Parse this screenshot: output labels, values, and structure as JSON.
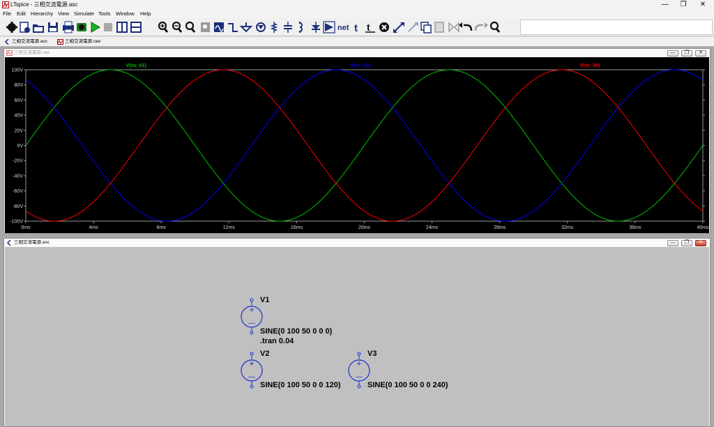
{
  "window": {
    "title": "LTspice - 三相交流電源.asc",
    "minimize": "—",
    "restore": "❐",
    "close": "✕"
  },
  "menu": [
    "File",
    "Edit",
    "Hierarchy",
    "View",
    "Simulate",
    "Tools",
    "Window",
    "Help"
  ],
  "toolbar": {
    "icons": [
      "gear-icon",
      "new-schematic-icon",
      "open-icon",
      "save-icon",
      "print-icon",
      "control-panel-icon",
      "run-icon",
      "stop-icon",
      "tile-vertical-icon",
      "tile-horizontal-icon",
      "zoom-in-icon",
      "zoom-out-icon",
      "zoom-fit-icon",
      "zoom-full-icon",
      "autorange-icon",
      "wire-icon",
      "ground-icon",
      "label-net-icon",
      "resistor-icon",
      "capacitor-icon",
      "inductor-icon",
      "diode-icon",
      "component-icon",
      "net-label-icon",
      "text-icon",
      "spice-directive-icon",
      "delete-icon",
      "move-icon",
      "drag-icon",
      "copy-icon",
      "paste-icon",
      "mirror-icon",
      "undo-icon",
      "redo-icon",
      "find-icon"
    ],
    "net_label": "net",
    "text_label": "t",
    "directive_label": "t"
  },
  "tabs": [
    {
      "label": "三相交流電源.asc",
      "icon": "schematic-icon"
    },
    {
      "label": "三相交流電源.raw",
      "icon": "waveform-icon"
    }
  ],
  "plot_window": {
    "title": "三相交流電源.raw",
    "icon": "waveform-icon"
  },
  "schematic_window": {
    "title": "三相交流電源.asc",
    "icon": "schematic-icon",
    "sources": [
      {
        "name": "V1",
        "value": "SINE(0 100 50 0 0 0)"
      },
      {
        "name": "V2",
        "value": "SINE(0 100 50 0 0 120)"
      },
      {
        "name": "V3",
        "value": "SINE(0 100 50 0 0 240)"
      }
    ],
    "directive": ".tran 0.04",
    "symbols": {
      "plus": "+",
      "minus": "—"
    }
  },
  "chart_data": {
    "type": "line",
    "background": "#000000",
    "grid": false,
    "x_unit": "ms",
    "xlim": [
      0,
      40
    ],
    "ylim": [
      -100,
      100
    ],
    "x_ticks": [
      "0ms",
      "4ms",
      "8ms",
      "12ms",
      "16ms",
      "20ms",
      "24ms",
      "28ms",
      "32ms",
      "36ms",
      "40ms"
    ],
    "x_tick_values": [
      0,
      4,
      8,
      12,
      16,
      20,
      24,
      28,
      32,
      36,
      40
    ],
    "y_ticks": [
      "100V",
      "80V",
      "60V",
      "40V",
      "20V",
      "0V",
      "-20V",
      "-40V",
      "-60V",
      "-80V",
      "-100V"
    ],
    "y_tick_values": [
      100,
      80,
      60,
      40,
      20,
      0,
      -20,
      -40,
      -60,
      -80,
      -100
    ],
    "legend_placement": "top",
    "series": [
      {
        "name": "V(nc_01)",
        "color": "#00c000",
        "frequency_hz": 50,
        "amplitude": 100,
        "phase_deg": 0,
        "x": [
          0,
          2,
          4,
          6,
          8,
          10,
          12,
          14,
          16,
          18,
          20,
          22,
          24,
          26,
          28,
          30,
          32,
          34,
          36,
          38,
          40
        ],
        "values": [
          0,
          58.8,
          95.1,
          95.1,
          58.8,
          0,
          -58.8,
          -95.1,
          -95.1,
          -58.8,
          0,
          58.8,
          95.1,
          95.1,
          58.8,
          0,
          -58.8,
          -95.1,
          -95.1,
          -58.8,
          0
        ]
      },
      {
        "name": "V(nc_03)",
        "color": "#0000ff",
        "frequency_hz": 50,
        "amplitude": 100,
        "phase_deg": 120,
        "x": [
          0,
          2,
          4,
          6,
          8,
          10,
          12,
          14,
          16,
          18,
          20,
          22,
          24,
          26,
          28,
          30,
          32,
          34,
          36,
          38,
          40
        ],
        "values": [
          86.6,
          40.7,
          -20.8,
          -74.3,
          -99.5,
          -86.6,
          -40.7,
          20.8,
          74.3,
          99.5,
          86.6,
          40.7,
          -20.8,
          -74.3,
          -99.5,
          -86.6,
          -40.7,
          20.8,
          74.3,
          99.5,
          86.6
        ]
      },
      {
        "name": "V(nc_05)",
        "color": "#ff0000",
        "frequency_hz": 50,
        "amplitude": 100,
        "phase_deg": 240,
        "x": [
          0,
          2,
          4,
          6,
          8,
          10,
          12,
          14,
          16,
          18,
          20,
          22,
          24,
          26,
          28,
          30,
          32,
          34,
          36,
          38,
          40
        ],
        "values": [
          -86.6,
          -99.5,
          -74.3,
          -20.8,
          40.7,
          86.6,
          99.5,
          74.3,
          20.8,
          -40.7,
          -86.6,
          -99.5,
          -74.3,
          -20.8,
          40.7,
          86.6,
          99.5,
          74.3,
          20.8,
          -40.7,
          -86.6
        ]
      }
    ]
  }
}
